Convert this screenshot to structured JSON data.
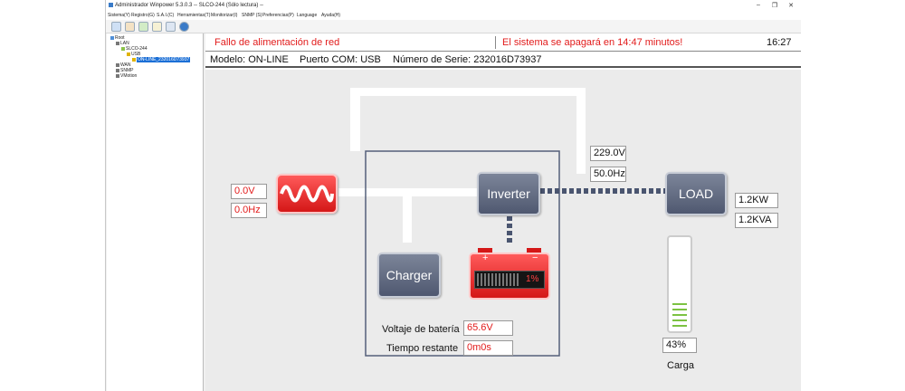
{
  "window": {
    "title": "Administrador Winpower 5.3.0.3 -- SLCO-244 (Sólo lectura) --",
    "controls": [
      "–",
      "❐",
      "✕"
    ]
  },
  "menu": [
    "Sistema(Y)",
    "Registro(G)",
    "S.A.I.(C)",
    "Herramientas(T)",
    "Monitorizar(I)",
    "SNMP (S)",
    "Preferencias(P)",
    "Language",
    "Ayuda(H)"
  ],
  "toolbar_icons": [
    "refresh-icon",
    "chart-icon",
    "user-icon",
    "document-icon",
    "calendar-icon",
    "help-icon"
  ],
  "tree": {
    "root": "Root",
    "lan": "LAN",
    "host": "SLCO-244",
    "usb": "USB",
    "device": "ON-LINE_232016D73937",
    "wan": "WAN",
    "snmp": "SNMP",
    "vmotion": "VMotion"
  },
  "alarms": {
    "left": "Fallo de alimentación de red",
    "right": "El sistema se apagará en 14:47 minutos!",
    "time": "16:27"
  },
  "info": {
    "model": "Modelo: ON-LINE",
    "com_port": "Puerto COM: USB",
    "serial": "Número de Serie: 232016D73937"
  },
  "input": {
    "voltage": "0.0V",
    "frequency": "0.0Hz"
  },
  "output": {
    "voltage": "229.0V",
    "frequency": "50.0Hz"
  },
  "load_values": {
    "kw": "1.2KW",
    "kva": "1.2KVA"
  },
  "blocks": {
    "inverter": "Inverter",
    "charger": "Charger",
    "load": "LOAD"
  },
  "battery": {
    "plus": "+",
    "minus": "−",
    "percent": "1%",
    "voltage_label": "Voltaje de batería",
    "voltage": "65.6V",
    "time_label": "Tiempo restante",
    "time": "0m0s"
  },
  "load_meter": {
    "percent_text": "43%",
    "label": "Carga",
    "level": 0.43
  },
  "colors": {
    "alarm": "#e21b1b",
    "battery": "#e8262b",
    "meter": "#7cc242",
    "selection": "#1b6fd6"
  }
}
